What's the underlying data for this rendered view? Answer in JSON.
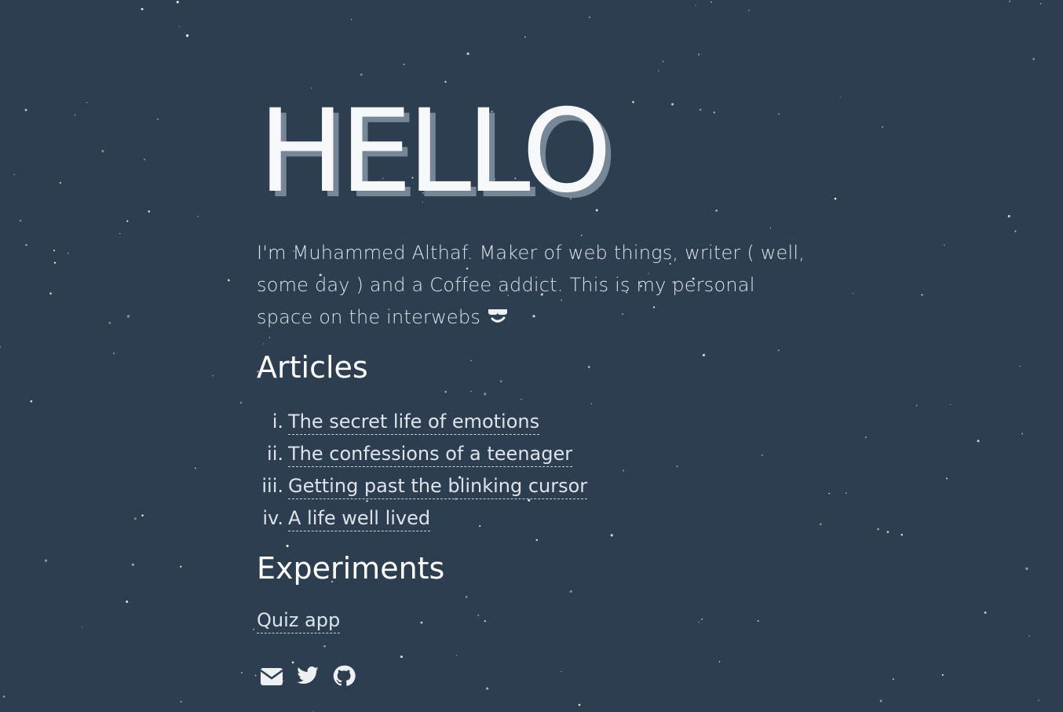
{
  "hero": {
    "title": "HELLO"
  },
  "intro": {
    "text": "I'm Muhammed Althaf. Maker of web things, writer ( well, some day ) and a Coffee addict. This is my personal space on the interwebs",
    "emoji_icon": "cool-face-icon"
  },
  "articles": {
    "heading": "Articles",
    "items": [
      {
        "numeral": "i.",
        "title": "The secret life of emotions"
      },
      {
        "numeral": "ii.",
        "title": "The confessions of a teenager"
      },
      {
        "numeral": "iii.",
        "title": "Getting past the blinking cursor"
      },
      {
        "numeral": "iv.",
        "title": "A life well lived"
      }
    ]
  },
  "experiments": {
    "heading": "Experiments",
    "items": [
      {
        "title": "Quiz app"
      }
    ]
  },
  "socials": [
    {
      "icon": "mail-icon"
    },
    {
      "icon": "twitter-icon"
    },
    {
      "icon": "github-icon"
    }
  ],
  "colors": {
    "background": "#2d3e50",
    "text": "#dde3e9",
    "title_shadow": "#788797"
  }
}
